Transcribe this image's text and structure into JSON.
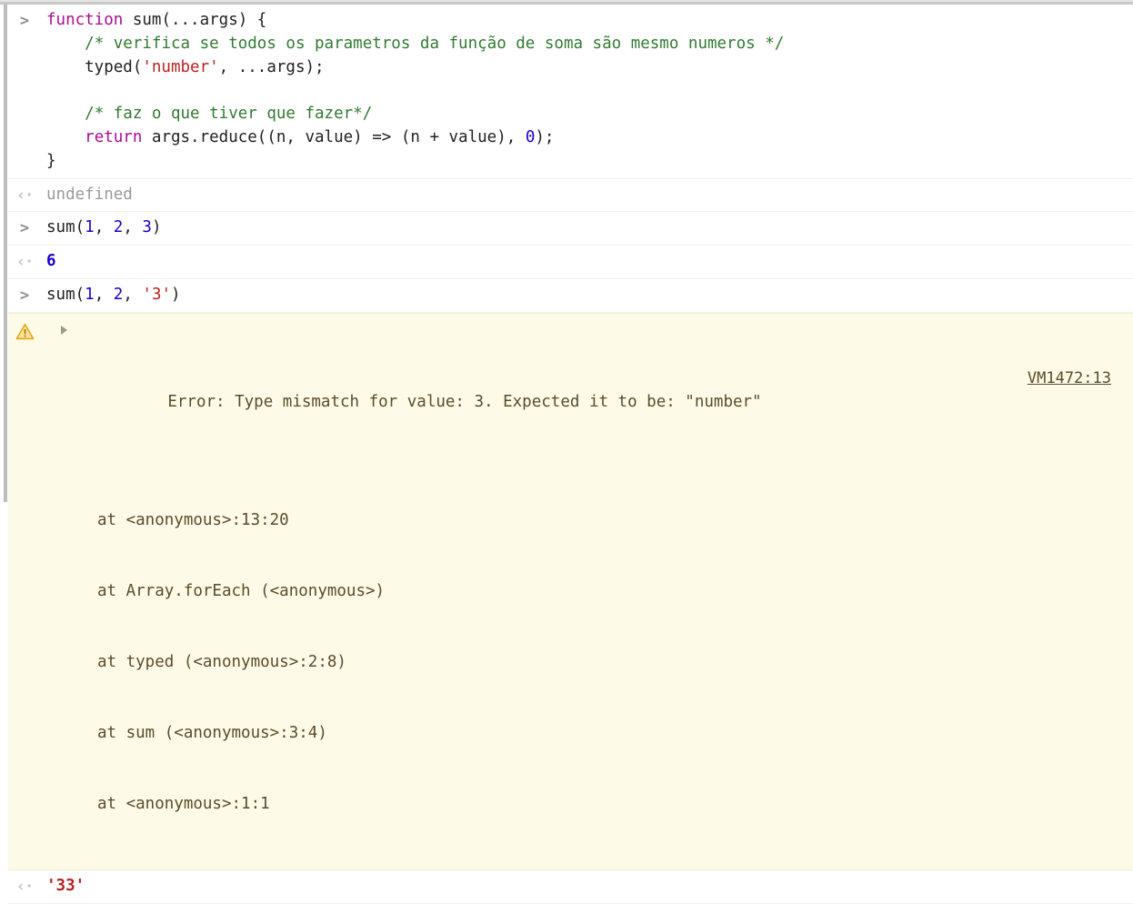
{
  "console": {
    "prompt_icon": ">",
    "result_icon": "‹·",
    "entries": [
      {
        "kind": "input",
        "lines": [
          [
            {
              "t": "function",
              "c": "kw"
            },
            {
              "t": " sum(...args) {",
              "c": "pln"
            }
          ],
          [
            {
              "t": "    ",
              "c": "pln"
            },
            {
              "t": "/* verifica se todos os parametros da função de soma são mesmo numeros */",
              "c": "com"
            }
          ],
          [
            {
              "t": "    typed(",
              "c": "pln"
            },
            {
              "t": "'number'",
              "c": "str"
            },
            {
              "t": ", ...args);",
              "c": "pln"
            }
          ],
          [
            {
              "t": "",
              "c": "pln"
            }
          ],
          [
            {
              "t": "    ",
              "c": "pln"
            },
            {
              "t": "/* faz o que tiver que fazer*/",
              "c": "com"
            }
          ],
          [
            {
              "t": "    ",
              "c": "pln"
            },
            {
              "t": "return",
              "c": "kw"
            },
            {
              "t": " args.reduce((n, value) => (n + value), ",
              "c": "pln"
            },
            {
              "t": "0",
              "c": "num"
            },
            {
              "t": ");",
              "c": "pln"
            }
          ],
          [
            {
              "t": "}",
              "c": "pln"
            }
          ]
        ]
      },
      {
        "kind": "output",
        "lines": [
          [
            {
              "t": "undefined",
              "c": "undef"
            }
          ]
        ]
      },
      {
        "kind": "input",
        "lines": [
          [
            {
              "t": "sum(",
              "c": "pln"
            },
            {
              "t": "1",
              "c": "num"
            },
            {
              "t": ", ",
              "c": "pln"
            },
            {
              "t": "2",
              "c": "num"
            },
            {
              "t": ", ",
              "c": "pln"
            },
            {
              "t": "3",
              "c": "num"
            },
            {
              "t": ")",
              "c": "pln"
            }
          ]
        ]
      },
      {
        "kind": "output",
        "lines": [
          [
            {
              "t": "6",
              "c": "numout"
            }
          ]
        ]
      },
      {
        "kind": "input",
        "lines": [
          [
            {
              "t": "sum(",
              "c": "pln"
            },
            {
              "t": "1",
              "c": "num"
            },
            {
              "t": ", ",
              "c": "pln"
            },
            {
              "t": "2",
              "c": "num"
            },
            {
              "t": ", ",
              "c": "pln"
            },
            {
              "t": "'3'",
              "c": "str"
            },
            {
              "t": ")",
              "c": "pln"
            }
          ]
        ]
      },
      {
        "kind": "output",
        "lines": [
          [
            {
              "t": "'33'",
              "c": "strout"
            }
          ]
        ]
      }
    ],
    "error": {
      "icon": "warning-triangle-icon",
      "expanded": true,
      "message": "Error: Type mismatch for value: 3. Expected it to be: \"number\"",
      "source_link": "VM1472:13",
      "stack": [
        "at <anonymous>:13:20",
        "at Array.forEach (<anonymous>)",
        "at typed (<anonymous>:2:8)",
        "at sum (<anonymous>:3:4)",
        "at <anonymous>:1:1"
      ]
    },
    "colors": {
      "keyword": "#aa0d91",
      "string": "#bb2222",
      "number": "#1c00cf",
      "comment": "#337a33",
      "error_background": "#fdfbe8",
      "error_text": "#5c4b2a",
      "warning_icon": "#f0b429",
      "undefined_text": "#9a9a9a"
    }
  }
}
